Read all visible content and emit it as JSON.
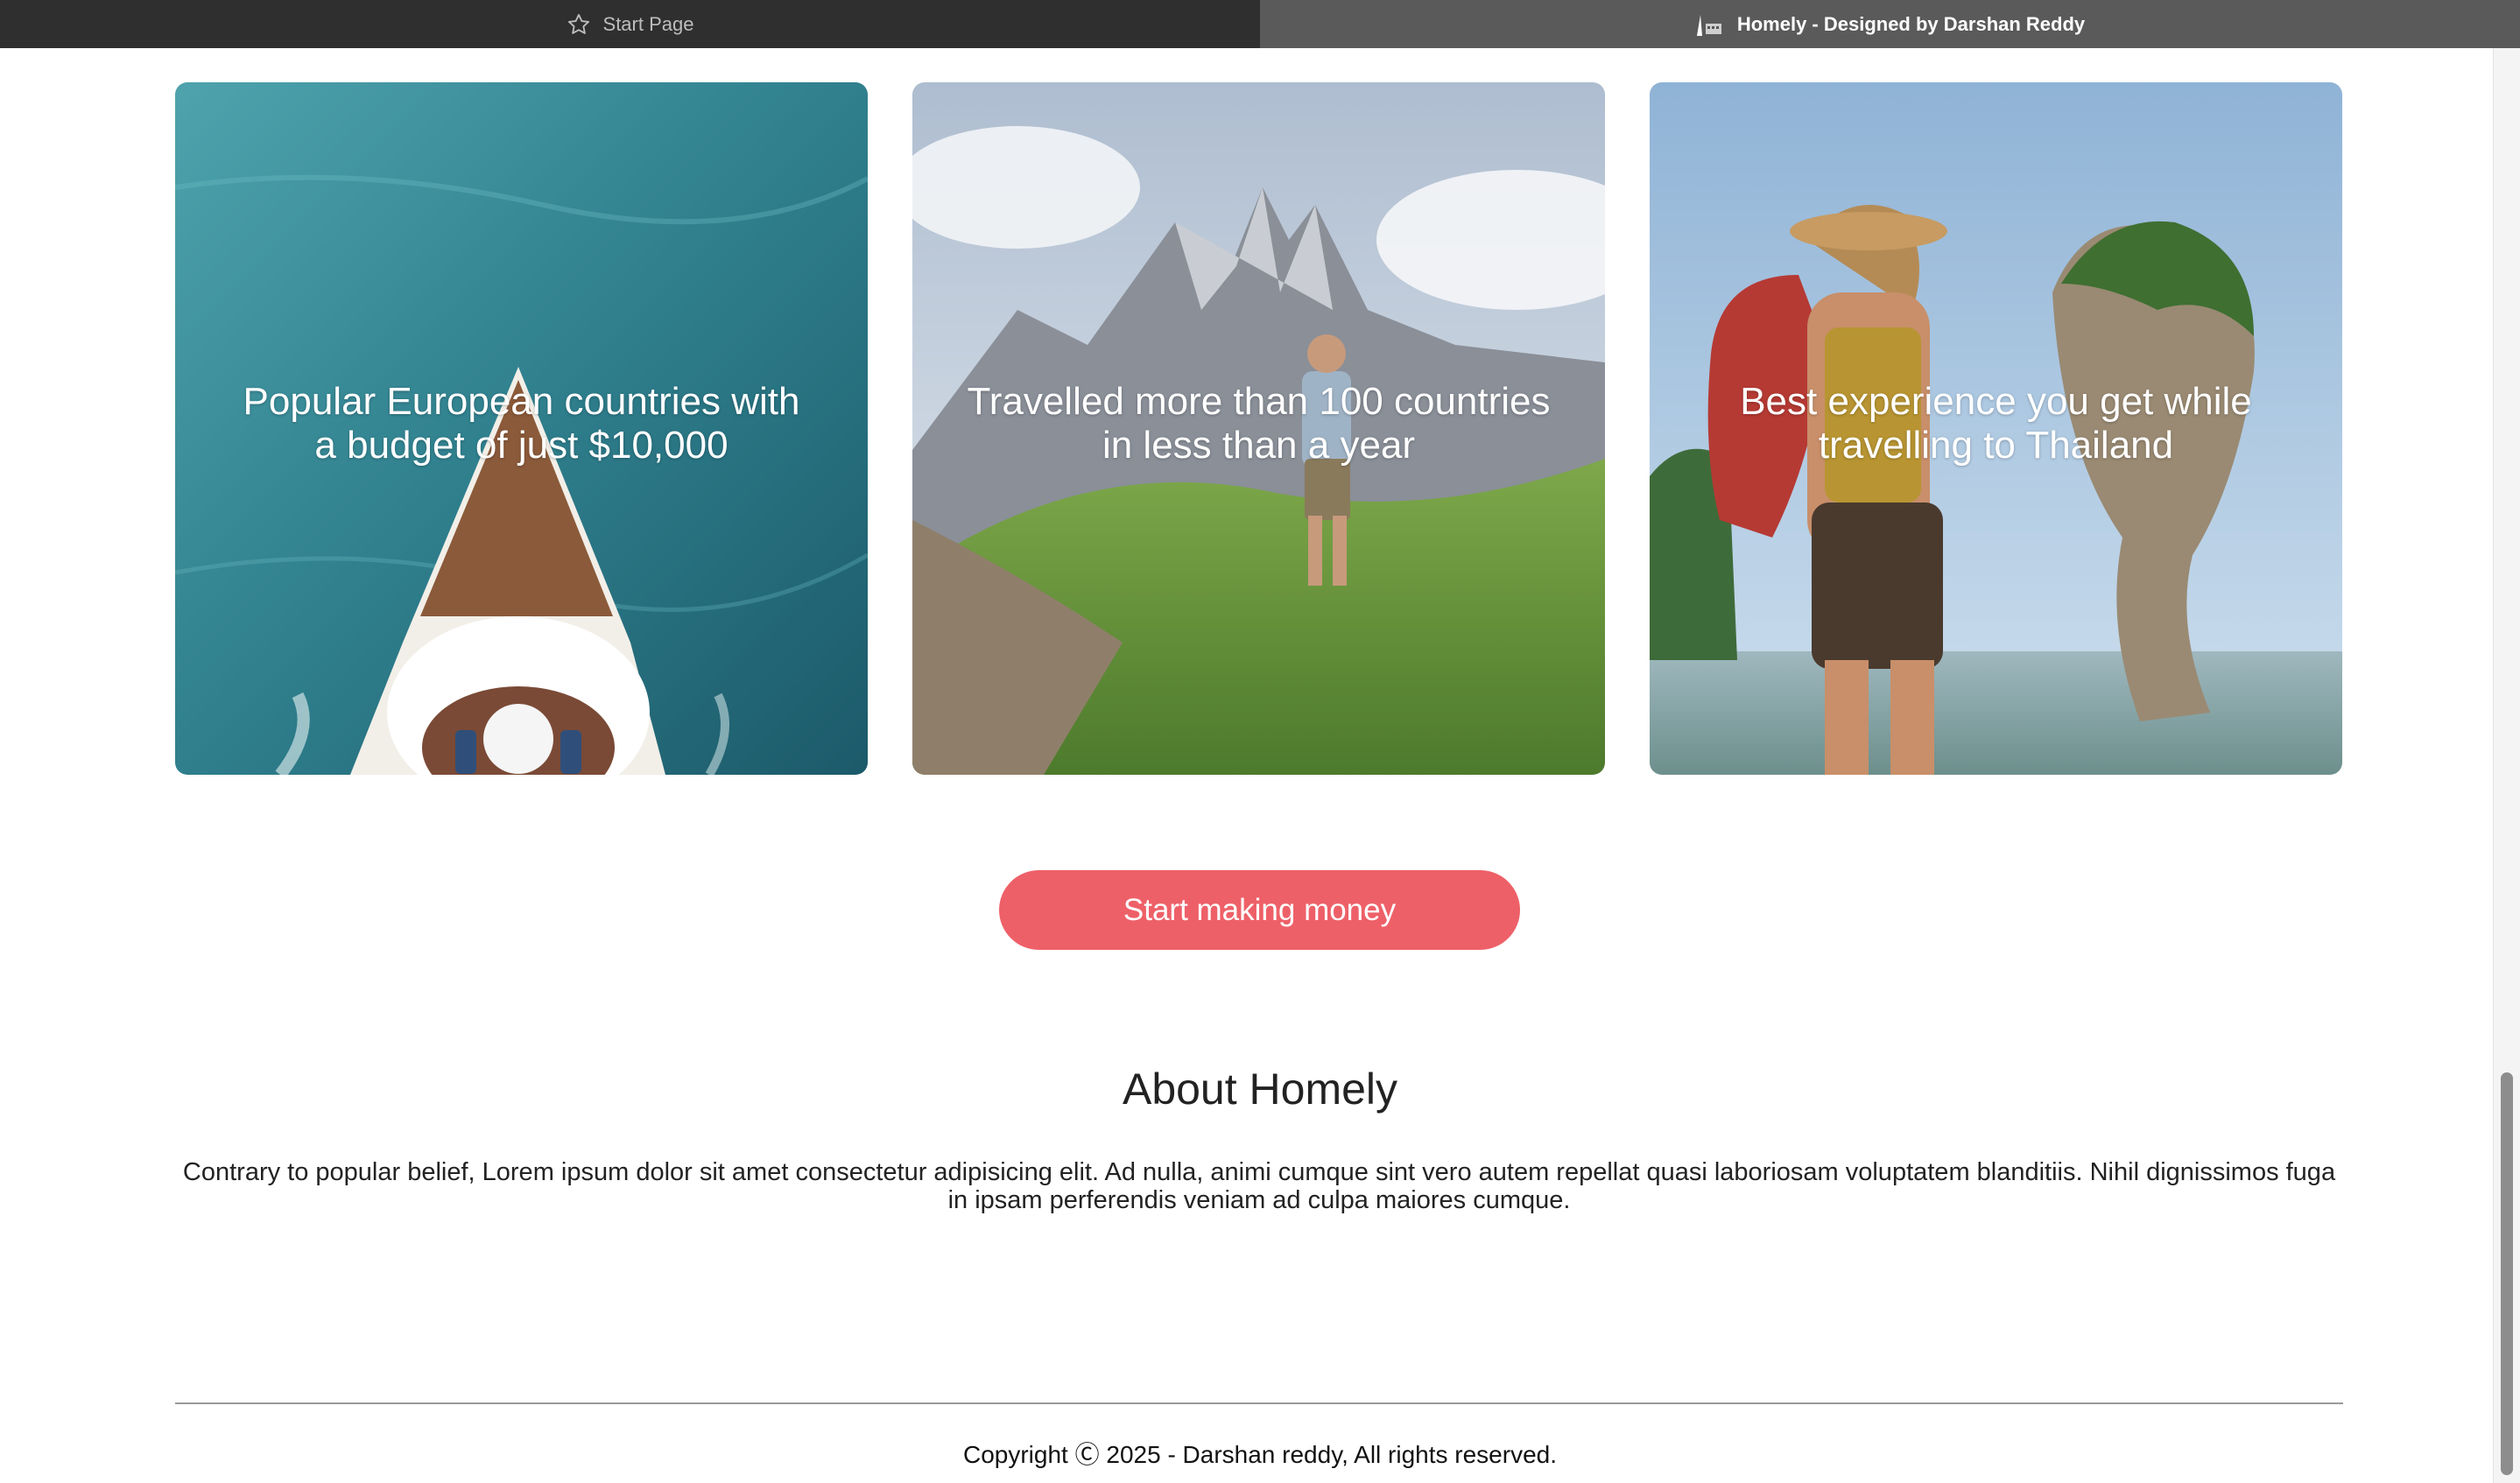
{
  "browser": {
    "tabs": [
      {
        "label": "Start Page",
        "icon": "star-icon",
        "active": false
      },
      {
        "label": "Homely - Designed by Darshan Reddy",
        "icon": "site-favicon-icon",
        "active": true
      }
    ]
  },
  "cards": [
    {
      "caption": "Popular European countries with a budget of just $10,000",
      "image": "boat-on-sea-aerial"
    },
    {
      "caption": "Travelled more than 100 countries in less than a year",
      "image": "hiker-in-mountains"
    },
    {
      "caption": "Best experience you get while travelling to Thailand",
      "image": "backpacker-at-rock-island"
    }
  ],
  "cta": {
    "label": "Start making money",
    "color": "#ee6068"
  },
  "about": {
    "title": "About Homely",
    "text": "Contrary to popular belief, Lorem ipsum dolor sit amet consectetur adipisicing elit. Ad nulla, animi cumque sint vero autem repellat quasi laboriosam voluptatem blanditiis. Nihil dignissimos fuga in ipsam perferendis veniam ad culpa maiores cumque."
  },
  "footer": {
    "copyright": "Copyright Ⓒ 2025 - Darshan reddy, All rights reserved."
  }
}
